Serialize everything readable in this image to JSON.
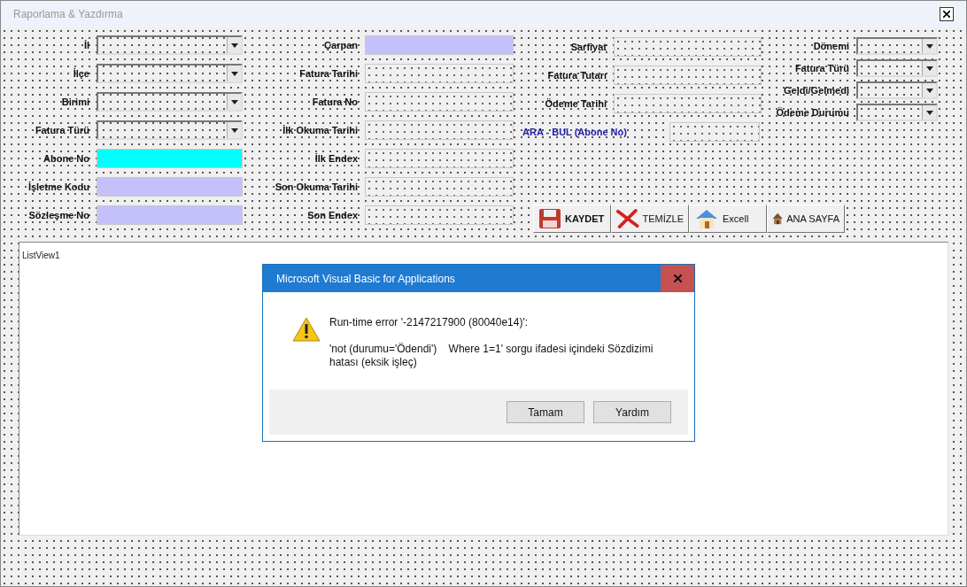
{
  "window": {
    "title": "Raporlama & Yazdırma"
  },
  "columns": [
    [
      {
        "label": "İl",
        "kind": "combo"
      },
      {
        "label": "İlçe",
        "kind": "combo"
      },
      {
        "label": "Birimi",
        "kind": "combo"
      },
      {
        "label": "Fatura Türü",
        "kind": "combo"
      },
      {
        "label": "Abone No",
        "kind": "text",
        "color": "#00ffff"
      },
      {
        "label": "İşletme Kodu",
        "kind": "text",
        "color": "#c4c0fa"
      },
      {
        "label": "Sözleşme No",
        "kind": "text",
        "color": "#c4c0fa"
      }
    ],
    [
      {
        "label": "Çarpan",
        "kind": "text",
        "color": "#c4c0fa"
      },
      {
        "label": "Fatura Tarihi",
        "kind": "text",
        "color": "#f0f0f0"
      },
      {
        "label": "Fatura No",
        "kind": "text",
        "color": "#f0f0f0"
      },
      {
        "label": "İlk Okuma Tarihi",
        "kind": "text",
        "color": "#f0f0f0"
      },
      {
        "label": "İlk Endex",
        "kind": "text",
        "color": "#f0f0f0"
      },
      {
        "label": "Son Okuma Tarihi",
        "kind": "text",
        "color": "#f0f0f0"
      },
      {
        "label": "Son Endex",
        "kind": "text",
        "color": "#f0f0f0"
      }
    ],
    [
      {
        "label": "Sarfiyat",
        "kind": "text",
        "color": "#f0f0f0"
      },
      {
        "label": "Fatura Tutarı",
        "kind": "text",
        "color": "#f0f0f0"
      },
      {
        "label": "Ödeme Tarihi",
        "kind": "text",
        "color": "#f0f0f0"
      },
      {
        "label": "ARA - BUL (Abone No)",
        "kind": "search",
        "color": "#f0f0f0"
      }
    ],
    [
      {
        "label": "Dönemi",
        "kind": "combo"
      },
      {
        "label": "Fatura Türü",
        "kind": "combo"
      },
      {
        "label": "Geldi/Gelmedi",
        "kind": "combo"
      },
      {
        "label": "Ödeme Durumu",
        "kind": "combo"
      }
    ]
  ],
  "buttons": [
    {
      "label": "KAYDET",
      "kind": "save",
      "emphasized": true
    },
    {
      "label": "TEMİZLE",
      "kind": "clear",
      "emphasized": false
    },
    {
      "label": "Excell",
      "kind": "excel",
      "emphasized": false
    },
    {
      "label": "ANA SAYFA",
      "kind": "home",
      "emphasized": false
    }
  ],
  "listview": {
    "label": "ListView1"
  },
  "dialog": {
    "title": "Microsoft Visual Basic for Applications",
    "heading": "Run-time error '-2147217900 (80040e14)':",
    "message": "'not (durumu='Ödendi')    Where 1=1' sorgu ifadesi içindeki Sözdizimi hatası (eksik işleç)",
    "buttons": [
      "Tamam",
      "Yardım"
    ]
  }
}
